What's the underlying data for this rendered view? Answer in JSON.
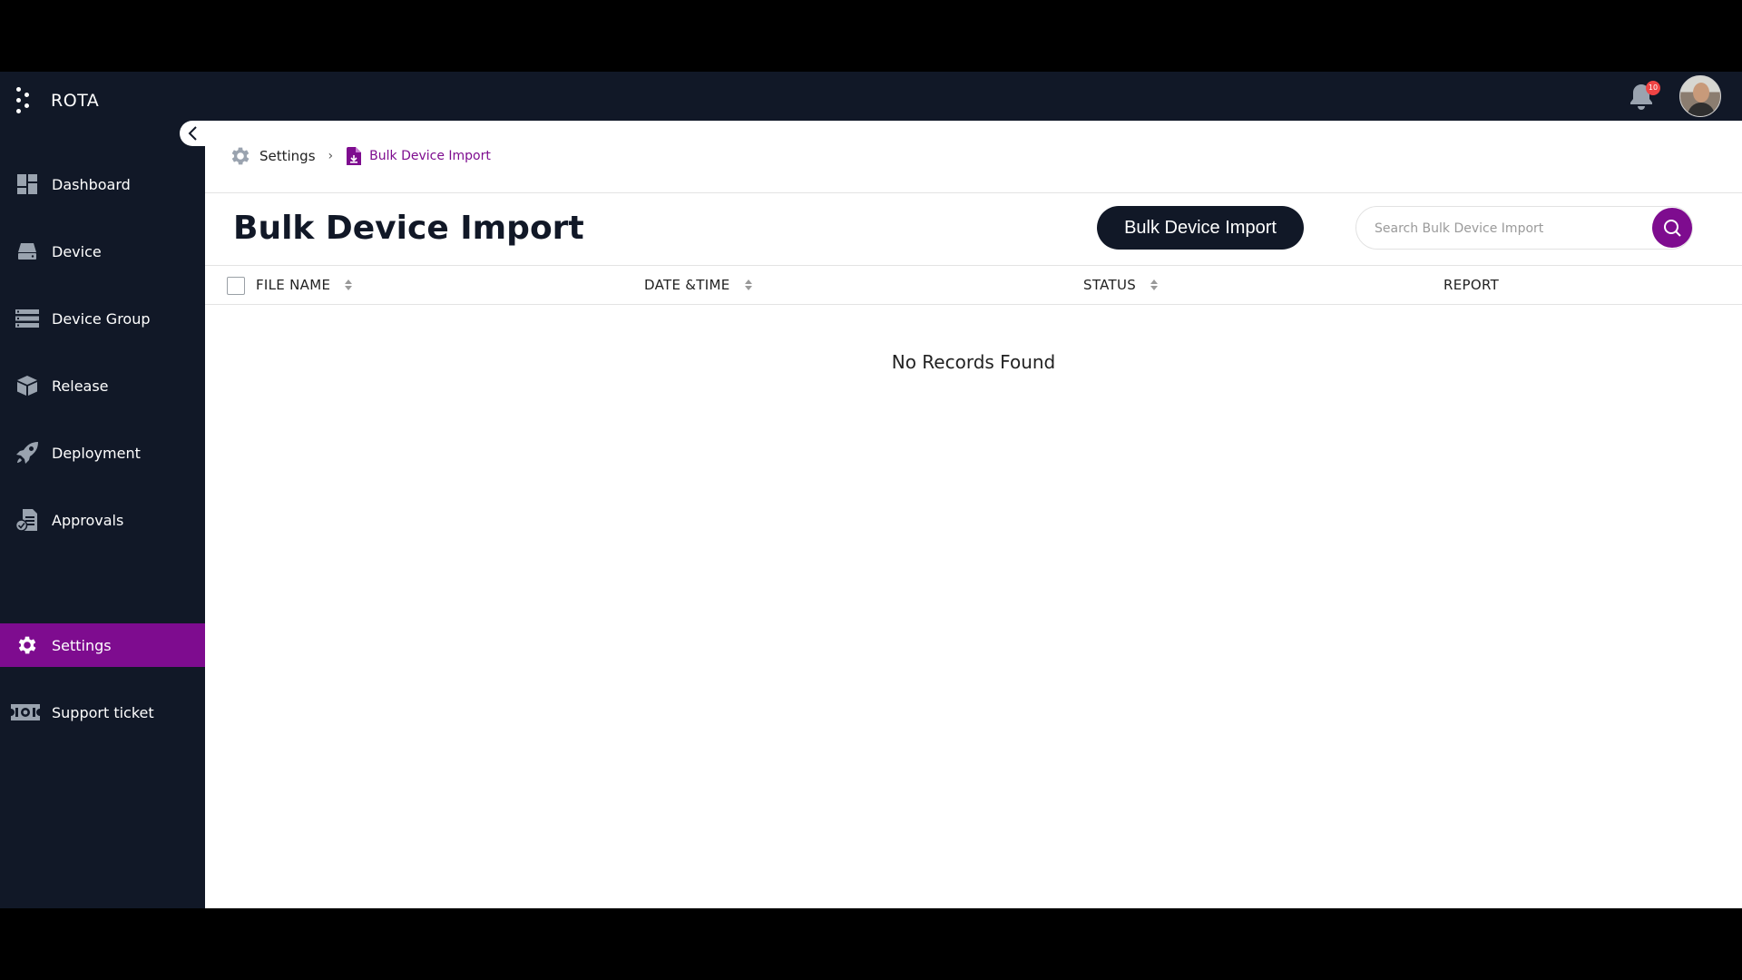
{
  "app": {
    "title": "ROTA"
  },
  "header": {
    "notification_count": "10"
  },
  "sidebar": {
    "items": [
      {
        "label": "Dashboard",
        "icon": "dashboard-icon"
      },
      {
        "label": "Device",
        "icon": "device-icon"
      },
      {
        "label": "Device Group",
        "icon": "device-group-icon"
      },
      {
        "label": "Release",
        "icon": "release-box-icon"
      },
      {
        "label": "Deployment",
        "icon": "rocket-icon"
      },
      {
        "label": "Approvals",
        "icon": "approvals-icon"
      },
      {
        "label": "Settings",
        "icon": "gear-icon",
        "active": true
      },
      {
        "label": "Support ticket",
        "icon": "ticket-icon"
      }
    ]
  },
  "breadcrumb": {
    "items": [
      {
        "label": "Settings",
        "icon": "gear-icon"
      },
      {
        "label": "Bulk Device Import",
        "icon": "file-import-icon"
      }
    ]
  },
  "page": {
    "title": "Bulk Device Import",
    "import_button_label": "Bulk Device Import",
    "search_placeholder": "Search Bulk Device Import"
  },
  "table": {
    "columns": [
      "FILE NAME",
      "DATE &TIME",
      "STATUS",
      "REPORT"
    ],
    "empty_message": "No Records Found"
  },
  "colors": {
    "sidebar_bg": "#111827",
    "accent": "#7e0c8f",
    "badge": "#ef4444"
  }
}
